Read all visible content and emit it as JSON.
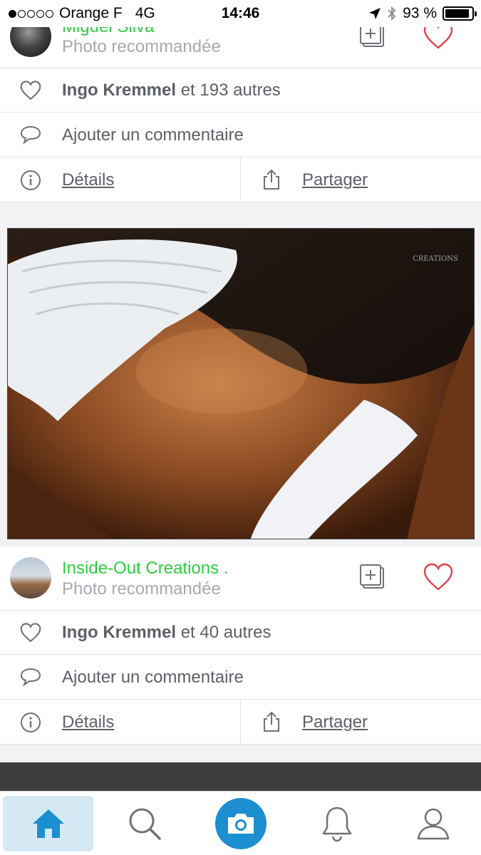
{
  "status_bar": {
    "carrier": "Orange F",
    "network": "4G",
    "time": "14:46",
    "battery": "93 %",
    "battery_level": 0.93
  },
  "post_top": {
    "author": "Miguel Silva",
    "subtitle": "Photo recommandée",
    "likes_name": "Ingo Kremmel",
    "likes_rest": " et 193 autres",
    "comment_placeholder": "Ajouter un commentaire",
    "details_label": "Détails",
    "share_label": "Partager"
  },
  "post_main": {
    "watermark": "CREATIONS",
    "author": "Inside-Out Creations .",
    "subtitle": "Photo recommandée",
    "likes_name": "Ingo Kremmel",
    "likes_rest": " et 40 autres",
    "comment_placeholder": "Ajouter un commentaire",
    "details_label": "Détails",
    "share_label": "Partager"
  },
  "colors": {
    "author_green": "#2ecc40",
    "heart_red": "#e0424a",
    "accent_blue": "#1b8fd0",
    "active_tab_bg": "#d5e9f5"
  },
  "tabbar": {
    "items": [
      "home-icon",
      "search-icon",
      "camera-icon",
      "bell-icon",
      "profile-icon"
    ],
    "active": "home-icon"
  }
}
